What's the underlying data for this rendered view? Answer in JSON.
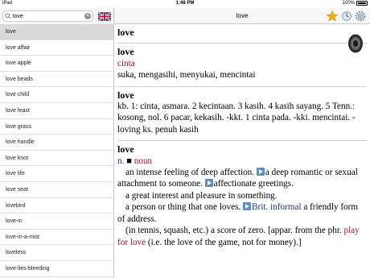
{
  "status": {
    "carrier": "iPad",
    "time": "1:48 PM",
    "battery": "100%"
  },
  "search": {
    "value": "love",
    "placeholder": ""
  },
  "word_list": [
    "love",
    "love affair",
    "love apple",
    "love beads",
    "love child",
    "love feast",
    "love grass",
    "love handle",
    "love knot",
    "love life",
    "love seat",
    "lovebird",
    "love-in",
    "love-in-a-mist",
    "loveless",
    "love-lies-bleeding"
  ],
  "nav": {
    "title": "love"
  },
  "entries": {
    "e1": {
      "headword": "love"
    },
    "e2": {
      "headword": "love",
      "translation": "cinta",
      "synonyms": "suka, mengasihi, menyukai, mencintai"
    },
    "e3": {
      "headword": "love",
      "text": "kb. 1: cinta, asmara. 2 kecintaan. 3 kasih. 4 kasih sayang. 5 Tenn.: kosong, nol. 6 pacar, kekasih. -kkt. 1 cinta pada. -kki. mencintai. -loving ks. penuh kasih"
    },
    "e4": {
      "headword": "love",
      "pos_abbr": "n.",
      "pos_full": "noun",
      "s1a": "an intense feeling of deep affection.",
      "s1b": "a deep romantic or sexual attachment to someone.",
      "s1c": "affectionate greetings.",
      "s2": "a great interest and pleasure in something.",
      "s3": "a person or thing that one loves.",
      "s3_label": "Brit. informal",
      "s3b": "a friendly form of address.",
      "s4a": "(in tennis, squash, etc.) a score of zero. [appar. from the phr.",
      "s4_phrase": "play for love",
      "s4b": "(i.e. the love of the game, not for money).]"
    }
  },
  "colors": {
    "accent_red": "#b0102a",
    "link_blue": "#1a2f9a",
    "selected_row": "#d9d9d9",
    "star": "#f0b400"
  }
}
